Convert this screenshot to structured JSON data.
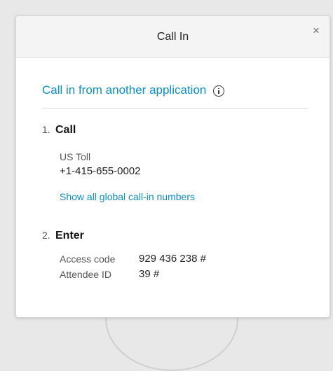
{
  "dialog": {
    "title": "Call In",
    "close_label": "×"
  },
  "section": {
    "heading": "Call in from another application",
    "info_icon": "info-icon"
  },
  "steps": [
    {
      "number": "1.",
      "title": "Call",
      "label": "US Toll",
      "phone": "+1-415-655-0002",
      "link": "Show all global call-in numbers"
    },
    {
      "number": "2.",
      "title": "Enter",
      "access_code_label": "Access code",
      "access_code_value": "929 436 238 #",
      "attendee_id_label": "Attendee ID",
      "attendee_id_value": "39 #"
    }
  ],
  "colors": {
    "accent": "#0a8fc7",
    "header_bg": "#f4f4f4",
    "backdrop": "#e8e8e8"
  }
}
